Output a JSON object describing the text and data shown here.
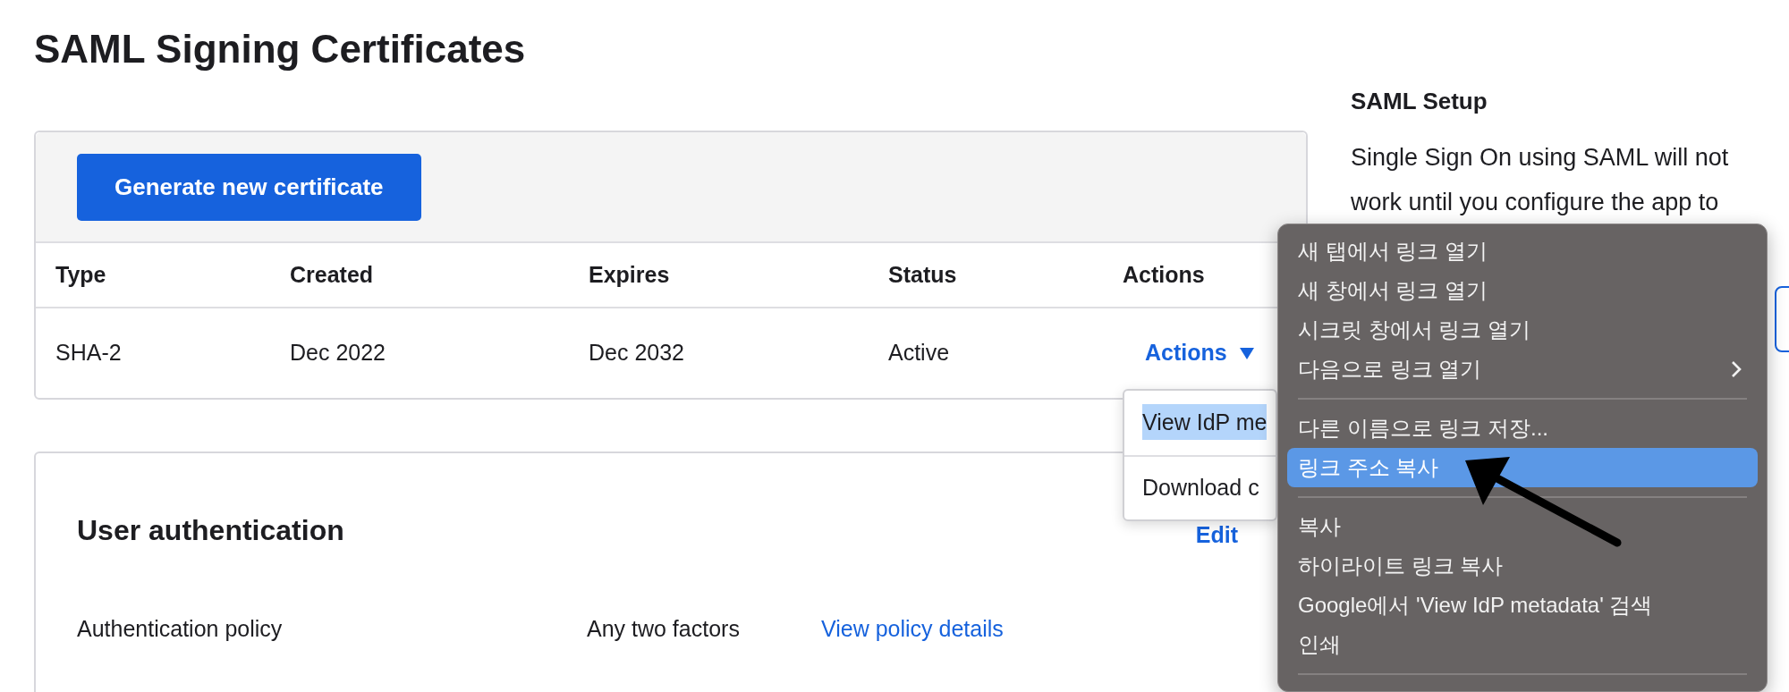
{
  "page_title": "SAML Signing Certificates",
  "certificates": {
    "generate_button": "Generate new certificate",
    "columns": [
      "Type",
      "Created",
      "Expires",
      "Status",
      "Actions"
    ],
    "rows": [
      {
        "type": "SHA-2",
        "created": "Dec 2022",
        "expires": "Dec 2032",
        "status": "Active",
        "actions": "Actions"
      }
    ],
    "actions_menu": [
      {
        "label": "View IdP me",
        "selected": true
      },
      {
        "label": "Download c",
        "selected": false
      }
    ]
  },
  "user_authentication": {
    "title": "User authentication",
    "edit": "Edit",
    "label": "Authentication policy",
    "value": "Any two factors",
    "link": "View policy details"
  },
  "sidebar": {
    "title": "SAML Setup",
    "text": "Single Sign On using SAML will not work until you configure the app to"
  },
  "context_menu": [
    [
      {
        "label": "새 탭에서 링크 열기",
        "selected": false,
        "submenu": false
      },
      {
        "label": "새 창에서 링크 열기",
        "selected": false,
        "submenu": false
      },
      {
        "label": "시크릿 창에서 링크 열기",
        "selected": false,
        "submenu": false
      },
      {
        "label": "다음으로 링크 열기",
        "selected": false,
        "submenu": true
      }
    ],
    [
      {
        "label": "다른 이름으로 링크 저장...",
        "selected": false,
        "submenu": false
      },
      {
        "label": "링크 주소 복사",
        "selected": true,
        "submenu": false
      }
    ],
    [
      {
        "label": "복사",
        "selected": false,
        "submenu": false
      },
      {
        "label": "하이라이트 링크 복사",
        "selected": false,
        "submenu": false
      },
      {
        "label": "Google에서 'View IdP metadata' 검색",
        "selected": false,
        "submenu": false
      },
      {
        "label": "인쇄",
        "selected": false,
        "submenu": false
      }
    ]
  ]
}
